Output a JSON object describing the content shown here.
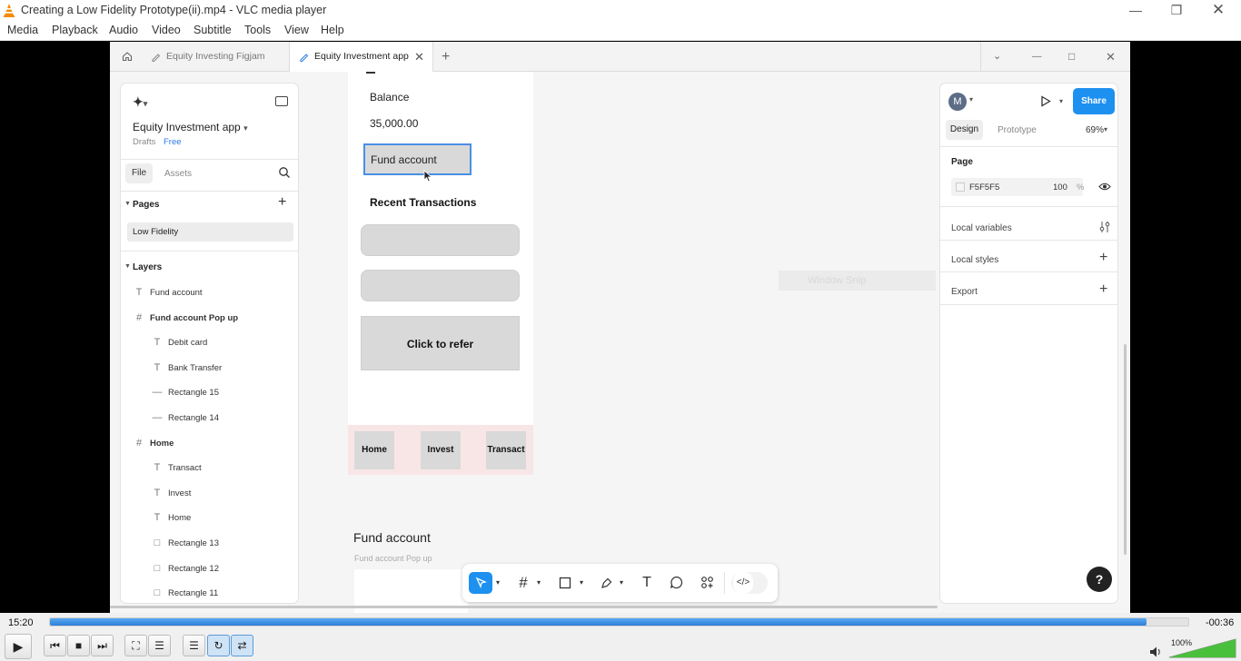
{
  "vlc": {
    "window_title": "Creating a Low Fidelity Prototype(ii).mp4 - VLC media player",
    "menu": [
      "Media",
      "Playback",
      "Audio",
      "Video",
      "Subtitle",
      "Tools",
      "View",
      "Help"
    ],
    "time_elapsed": "15:20",
    "time_remaining": "-00:36",
    "progress_fraction": 0.963,
    "volume": "100%",
    "volume_fraction": 1.0
  },
  "figma": {
    "tabs": [
      {
        "label": "Equity Investing Figjam",
        "active": false
      },
      {
        "label": "Equity Investment app",
        "active": true
      }
    ],
    "file_name": "Equity Investment app",
    "drafts_label": "Drafts",
    "plan_badge": "Free",
    "panel_tabs": {
      "file": "File",
      "assets": "Assets"
    },
    "pages_heading": "Pages",
    "pages": [
      "Low Fidelity"
    ],
    "layers_heading": "Layers",
    "layers": [
      {
        "type": "text",
        "name": "Fund account",
        "indent": 0
      },
      {
        "type": "frame",
        "name": "Fund account Pop up",
        "indent": 0
      },
      {
        "type": "text",
        "name": "Debit card",
        "indent": 1
      },
      {
        "type": "text",
        "name": "Bank Transfer",
        "indent": 1
      },
      {
        "type": "line",
        "name": "Rectangle 15",
        "indent": 1
      },
      {
        "type": "line",
        "name": "Rectangle 14",
        "indent": 1
      },
      {
        "type": "frame",
        "name": "Home",
        "indent": 0
      },
      {
        "type": "text",
        "name": "Transact",
        "indent": 1
      },
      {
        "type": "text",
        "name": "Invest",
        "indent": 1
      },
      {
        "type": "text",
        "name": "Home",
        "indent": 1
      },
      {
        "type": "rect",
        "name": "Rectangle 13",
        "indent": 1
      },
      {
        "type": "rect",
        "name": "Rectangle 12",
        "indent": 1
      },
      {
        "type": "rect",
        "name": "Rectangle 11",
        "indent": 1
      }
    ],
    "canvas": {
      "balance_label": "Balance",
      "balance_value": "35,000.00",
      "fund_button": "Fund account",
      "recent_heading": "Recent Transactions",
      "refer_label": "Click to refer",
      "nav": [
        "Home",
        "Invest",
        "Transact"
      ],
      "frame_title": "Fund account",
      "frame_subtitle": "Fund account Pop up",
      "window_snip": "Window Snip"
    },
    "right": {
      "avatar_initial": "M",
      "share": "Share",
      "tab_design": "Design",
      "tab_prototype": "Prototype",
      "zoom": "69%",
      "page_heading": "Page",
      "page_color": "F5F5F5",
      "page_opacity": "100",
      "percent": "%",
      "local_variables": "Local variables",
      "local_styles": "Local styles",
      "export": "Export"
    },
    "help": "?"
  }
}
